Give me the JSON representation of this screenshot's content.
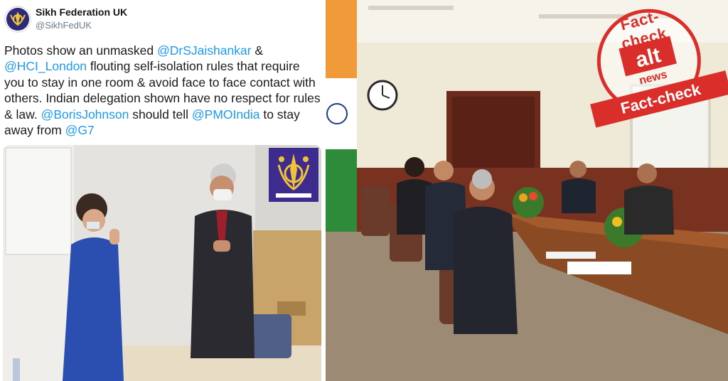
{
  "tweet": {
    "account_name": "Sikh Federation UK",
    "handle": "@SikhFedUK",
    "text": {
      "t1": "Photos show an unmasked ",
      "m1": "@DrSJaishankar",
      "t2": " & ",
      "m2": "@HCI_London",
      "t3": " flouting self-isolation rules that require you to stay in one room & avoid face to face contact with others. Indian delegation shown have no respect for rules & law.  ",
      "m3": "@BorisJohnson",
      "t4": " should tell ",
      "m4": "@PMOIndia",
      "t5": " to stay away from ",
      "m5": "@G7"
    },
    "mention_color": "#1d9bf0"
  },
  "stamp": {
    "top_text": "Fact-check",
    "bottom_text": "Fact-check",
    "logo_text": "alt news",
    "color": "#d92e2a"
  }
}
